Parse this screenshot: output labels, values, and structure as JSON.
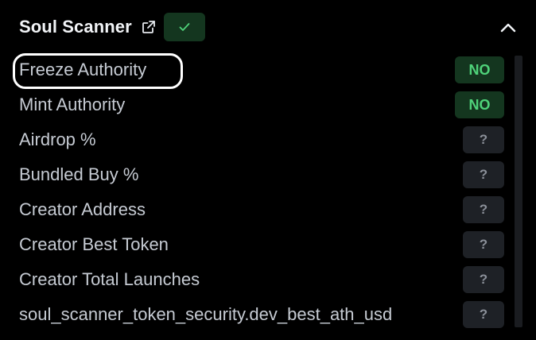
{
  "header": {
    "title": "Soul Scanner",
    "check_mark": "✓",
    "external_link_icon": "external-link-icon",
    "collapse_icon": "chevron-up-icon"
  },
  "colors": {
    "background": "#000000",
    "positive_bg": "#14361f",
    "positive_text": "#4fd37a",
    "unknown_bg": "#1e2126",
    "unknown_text": "#8a8f98"
  },
  "rows": [
    {
      "label": "Freeze Authority",
      "value": "NO",
      "status": "no"
    },
    {
      "label": "Mint Authority",
      "value": "NO",
      "status": "no"
    },
    {
      "label": "Airdrop %",
      "value": "?",
      "status": "unknown"
    },
    {
      "label": "Bundled Buy %",
      "value": "?",
      "status": "unknown"
    },
    {
      "label": "Creator Address",
      "value": "?",
      "status": "unknown"
    },
    {
      "label": "Creator Best Token",
      "value": "?",
      "status": "unknown"
    },
    {
      "label": "Creator Total Launches",
      "value": "?",
      "status": "unknown"
    },
    {
      "label": "soul_scanner_token_security.dev_best_ath_usd",
      "value": "?",
      "status": "unknown"
    }
  ]
}
